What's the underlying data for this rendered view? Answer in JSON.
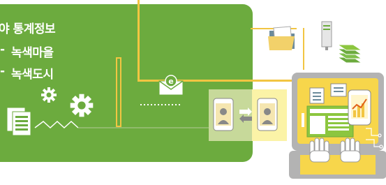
{
  "texts": {
    "line1": "야 통계정보",
    "line2": "녹색마을",
    "line3": "녹색도시",
    "bullet": "-"
  },
  "colors": {
    "panel_green": "#6cab3e",
    "line_yellow": "#f2c542",
    "computer_gray": "#b3b3b3",
    "screen_yellow": "#f7d64b",
    "screen_green": "#8cc63f"
  },
  "icons": [
    "gear-icon",
    "document-icon",
    "envelope-icon",
    "smartphone-icon",
    "folder-icon",
    "server-icon",
    "stack-icon",
    "hand-icon",
    "chart-icon"
  ]
}
